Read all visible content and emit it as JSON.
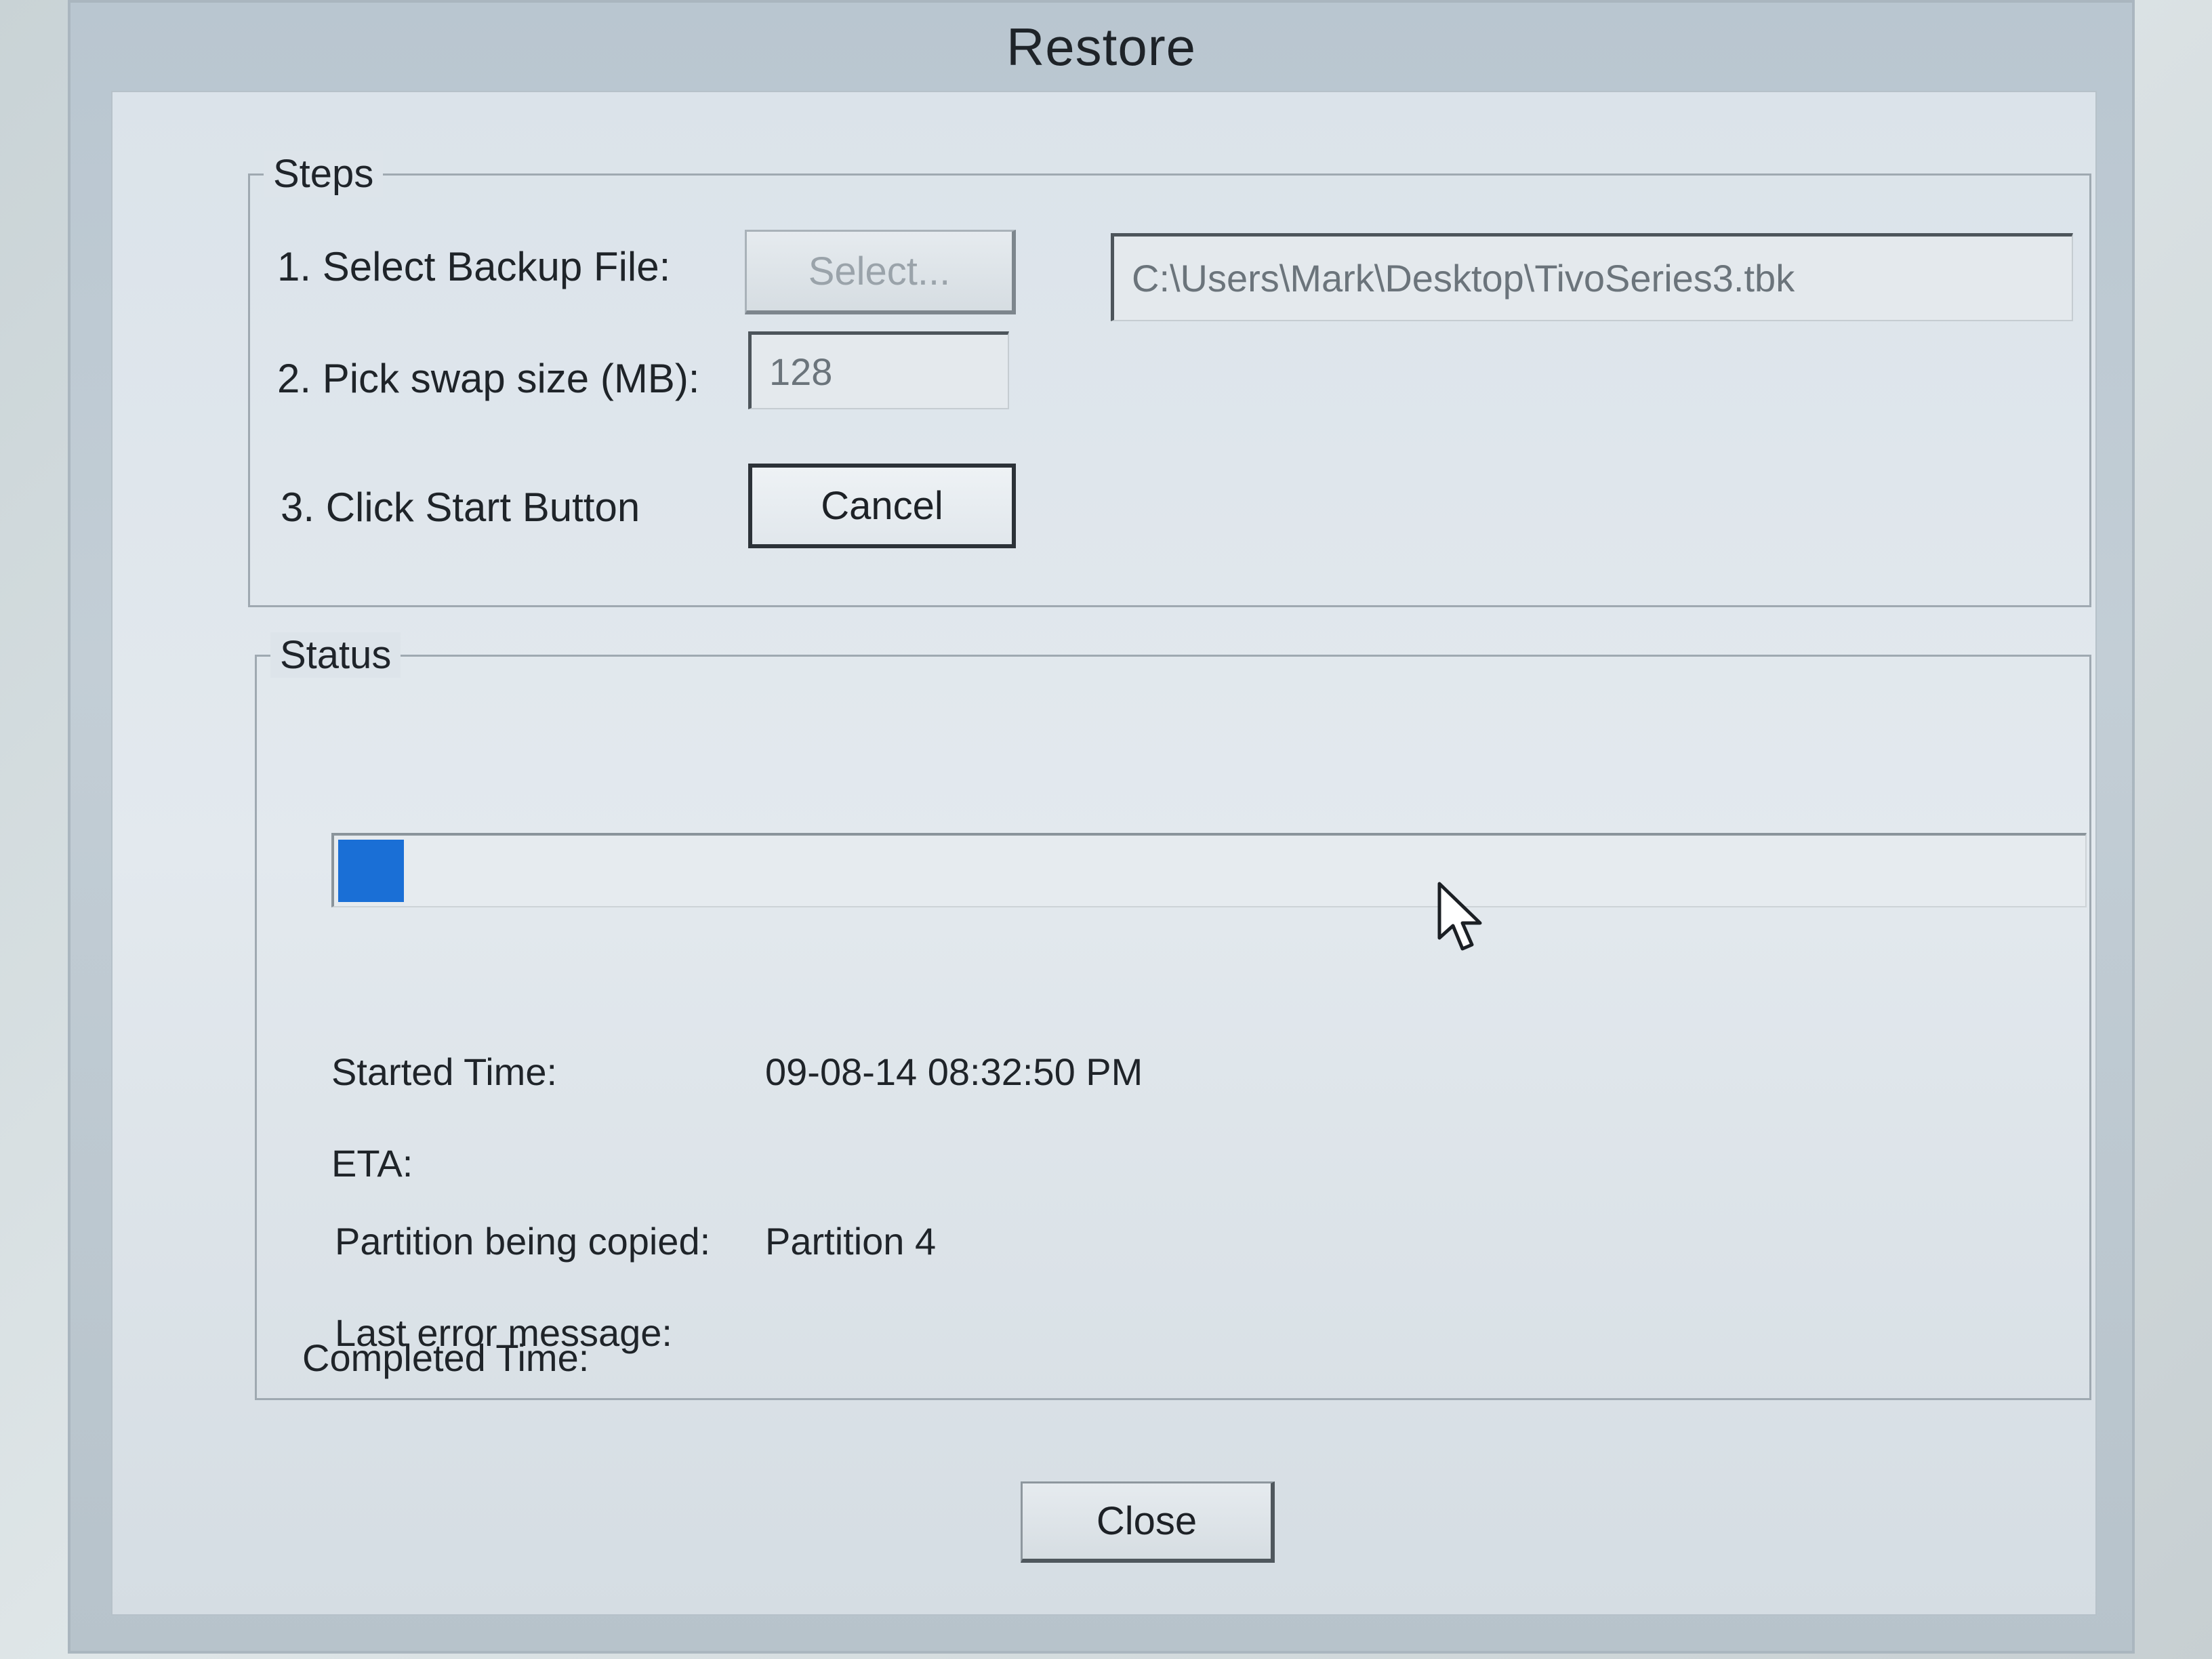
{
  "window": {
    "title": "Restore"
  },
  "steps": {
    "legend": "Steps",
    "step1_label": "1. Select Backup File:",
    "select_button_label": "Select...",
    "backup_file_path": "C:\\Users\\Mark\\Desktop\\TivoSeries3.tbk",
    "step2_label": "2. Pick swap size (MB):",
    "swap_size_value": "128",
    "step3_label": "3. Click Start Button",
    "start_button_label": "Cancel"
  },
  "status": {
    "legend": "Status",
    "progress_fraction": 0.04,
    "progress_color": "#1a6fd6",
    "started_label": "Started Time:",
    "started_value": "09-08-14 08:32:50 PM",
    "eta_label": "ETA:",
    "partition_label": "Partition being copied:",
    "partition_value": "Partition 4",
    "last_error_label": "Last error message:",
    "completed_label": "Completed Time:"
  },
  "footer": {
    "close_button_label": "Close"
  },
  "icons": {
    "cursor": "mouse-pointer-icon"
  }
}
